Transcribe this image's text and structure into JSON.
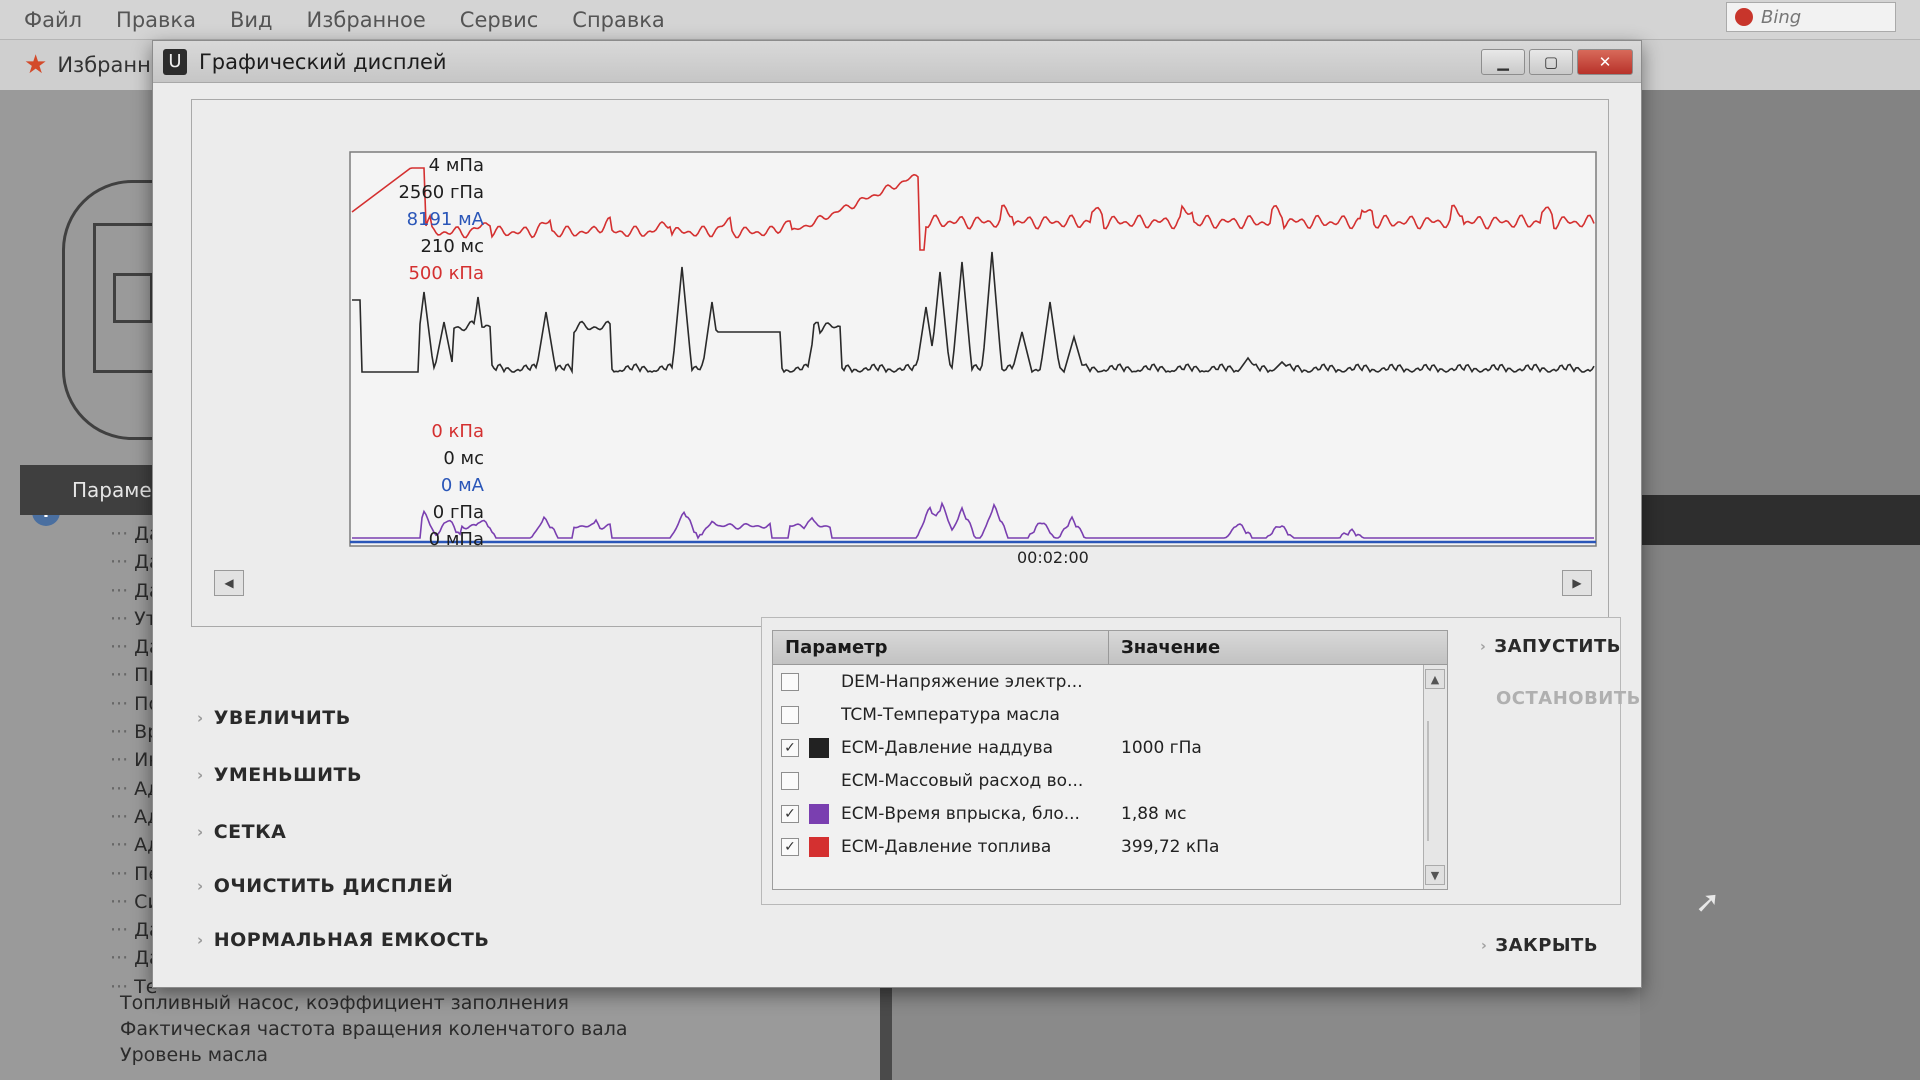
{
  "background_app": {
    "menu": [
      "Файл",
      "Правка",
      "Вид",
      "Избранное",
      "Сервис",
      "Справка"
    ],
    "search_engine": "Bing",
    "favorites_label": "Избранн",
    "params_header": "Параме",
    "tree_items": [
      "Да",
      "Да",
      "Да",
      "Уте",
      "Да",
      "Пр",
      "По",
      "Вр",
      "Ин",
      "Ад",
      "Ад",
      "Ад",
      "Пе",
      "Си",
      "Да",
      "Да",
      "Те"
    ],
    "tree_bottom_items": [
      "Топливный насос, коэффициент заполнения",
      "Фактическая частота вращения коленчатого вала",
      "Уровень масла"
    ]
  },
  "dialog": {
    "title": "Графический дисплей",
    "close_glyph": "✕",
    "chart": {
      "max_labels": [
        {
          "text": "4 мПа",
          "color": "#1e1e1e"
        },
        {
          "text": "2560 гПа",
          "color": "#1e1e1e"
        },
        {
          "text": "8191 мА",
          "color": "#2a56b8"
        },
        {
          "text": "210 мс",
          "color": "#1e1e1e"
        },
        {
          "text": "500 кПа",
          "color": "#d43030"
        }
      ],
      "min_labels": [
        {
          "text": "0 кПа",
          "color": "#d43030"
        },
        {
          "text": "0 мс",
          "color": "#1e1e1e"
        },
        {
          "text": "0 мА",
          "color": "#2a56b8"
        },
        {
          "text": "0 гПа",
          "color": "#1e1e1e"
        },
        {
          "text": "0 мПа",
          "color": "#1e1e1e"
        }
      ],
      "time_label": "00:02:00"
    },
    "actions": [
      {
        "name": "zoom-in-button",
        "label": "УВЕЛИЧИТЬ"
      },
      {
        "name": "zoom-out-button",
        "label": "УМЕНЬШИТЬ"
      },
      {
        "name": "grid-button",
        "label": "СЕТКА"
      },
      {
        "name": "clear-display-button",
        "label": "ОЧИСТИТЬ ДИСПЛЕЙ"
      },
      {
        "name": "normal-capacity-button",
        "label": "НОРМАЛЬНАЯ ЕМКОСТЬ"
      }
    ],
    "table": {
      "col_param": "Параметр",
      "col_value": "Значение",
      "rows": [
        {
          "checked": false,
          "color": "",
          "param": "DEM-Напряжение электр...",
          "value": ""
        },
        {
          "checked": false,
          "color": "",
          "param": "TCM-Температура масла",
          "value": ""
        },
        {
          "checked": true,
          "color": "#222222",
          "param": "ECM-Давление наддува",
          "value": "1000 гПа"
        },
        {
          "checked": false,
          "color": "",
          "param": "ECM-Массовый расход во...",
          "value": ""
        },
        {
          "checked": true,
          "color": "#7a3fb0",
          "param": "ECM-Время впрыска, бло...",
          "value": "1,88 мс"
        },
        {
          "checked": true,
          "color": "#d43030",
          "param": "ECM-Давление топлива",
          "value": "399,72 кПа"
        }
      ]
    },
    "start_label": "ЗАПУСТИТЬ",
    "stop_label": "ОСТАНОВИТЬ",
    "close_label": "ЗАКРЫТЬ",
    "series_colors": {
      "fuel_pressure": "#d43030",
      "boost_pressure": "#2a2a2a",
      "injection_time": "#7a3fb0",
      "current": "#2a56b8"
    }
  }
}
